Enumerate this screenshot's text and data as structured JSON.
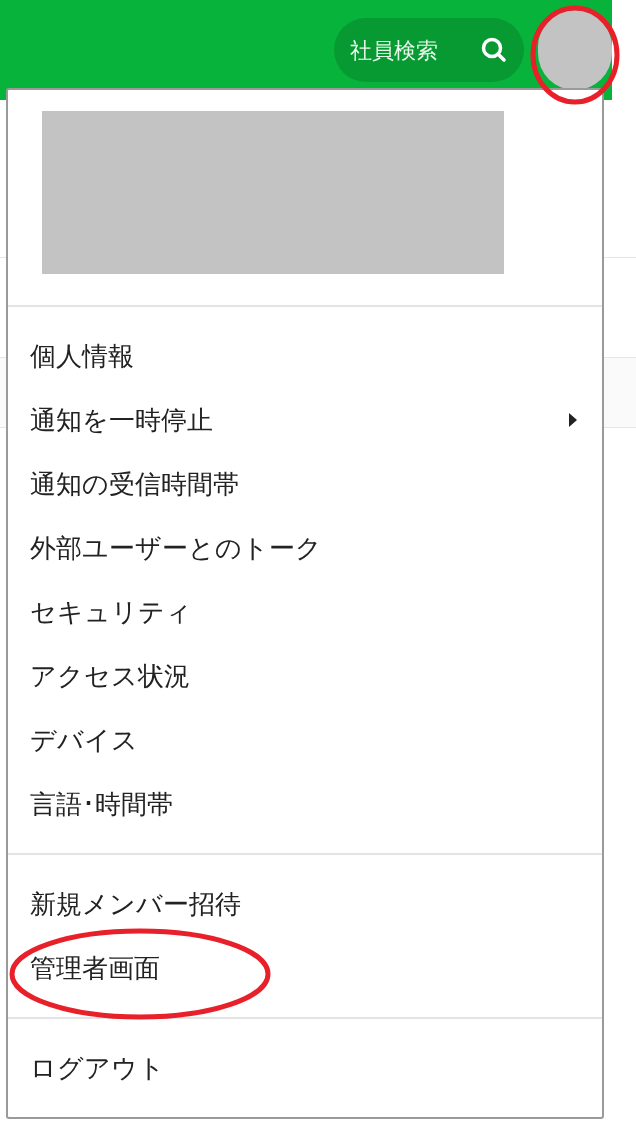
{
  "header": {
    "search": {
      "label": "社員検索"
    }
  },
  "menu": {
    "groups": [
      {
        "items": [
          {
            "label": "個人情報",
            "kind": "plain"
          },
          {
            "label": "通知を一時停止",
            "kind": "submenu"
          },
          {
            "label": "通知の受信時間帯",
            "kind": "plain"
          },
          {
            "label": "外部ユーザーとのトーク",
            "kind": "plain"
          },
          {
            "label": "セキュリティ",
            "kind": "plain"
          },
          {
            "label": "アクセス状況",
            "kind": "plain"
          },
          {
            "label": "デバイス",
            "kind": "plain"
          },
          {
            "label": "言語･時間帯",
            "kind": "plain"
          }
        ]
      },
      {
        "items": [
          {
            "label": "新規メンバー招待",
            "kind": "plain"
          },
          {
            "label": "管理者画面",
            "kind": "plain",
            "highlighted": true
          }
        ]
      },
      {
        "items": [
          {
            "label": "ログアウト",
            "kind": "plain"
          }
        ]
      }
    ]
  },
  "annotations": {
    "avatar_circled": true
  }
}
